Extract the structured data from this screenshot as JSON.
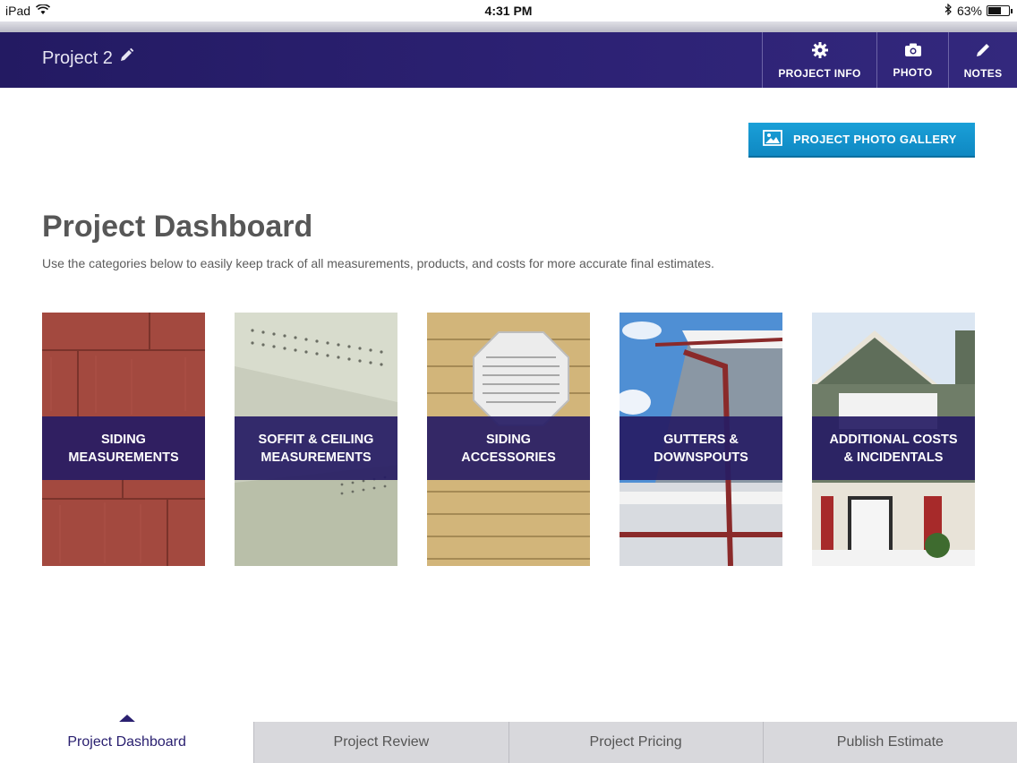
{
  "status_bar": {
    "device": "iPad",
    "time": "4:31 PM",
    "battery": "63%",
    "battery_level": 0.63
  },
  "header": {
    "project_title": "Project 2",
    "buttons": [
      {
        "label": "PROJECT INFO",
        "icon": "gear-icon"
      },
      {
        "label": "PHOTO",
        "icon": "camera-icon"
      },
      {
        "label": "NOTES",
        "icon": "pencil-icon"
      }
    ]
  },
  "gallery_button": {
    "label": "PROJECT PHOTO GALLERY",
    "icon": "image-icon"
  },
  "main": {
    "title": "Project Dashboard",
    "subtitle": "Use the categories below to easily keep track of all measurements, products, and costs for more accurate final estimates."
  },
  "categories": [
    {
      "label": "SIDING\nMEASUREMENTS"
    },
    {
      "label": "SOFFIT & CEILING\nMEASUREMENTS"
    },
    {
      "label": "SIDING\nACCESSORIES"
    },
    {
      "label": "GUTTERS &\nDOWNSPOUTS"
    },
    {
      "label": "ADDITIONAL COSTS\n& INCIDENTALS"
    }
  ],
  "tabs": [
    {
      "label": "Project Dashboard",
      "active": true
    },
    {
      "label": "Project Review",
      "active": false
    },
    {
      "label": "Project Pricing",
      "active": false
    },
    {
      "label": "Publish Estimate",
      "active": false
    }
  ],
  "colors": {
    "header": "#2d2275",
    "gallery": "#1aa0d8",
    "band": "#261c64",
    "active_tab_text": "#2a2070"
  }
}
